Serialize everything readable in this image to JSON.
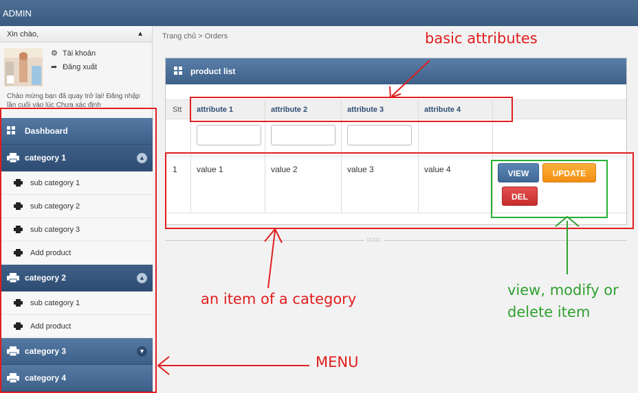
{
  "topbar": {
    "title": "ADMIN"
  },
  "sidebar": {
    "welcome": "Xin chào,",
    "user_links": [
      {
        "label": "Tài khoản",
        "icon": "gear-icon"
      },
      {
        "label": "Đăng xuất",
        "icon": "share-arrow-icon"
      }
    ],
    "greeting": "Chào mừng bạn đã quay trở lại! Đăng nhập lần cuối vào lúc Chưa xác định",
    "dashboard": {
      "label": "Dashboard",
      "icon": "grid-icon"
    },
    "categories": [
      {
        "label": "category 1",
        "expanded": true,
        "items": [
          "sub category 1",
          "sub category 2",
          "sub category 3",
          "Add product"
        ]
      },
      {
        "label": "category 2",
        "expanded": true,
        "items": [
          "sub category 1",
          "Add product"
        ]
      },
      {
        "label": "category 3",
        "expanded": false,
        "items": []
      },
      {
        "label": "category 4",
        "expanded": false,
        "items": []
      }
    ]
  },
  "breadcrumb": {
    "home": "Trang chủ",
    "separator": ">",
    "current": "Orders"
  },
  "panel": {
    "title": "product list",
    "columns": [
      "Stt",
      "attribute 1",
      "attribute 2",
      "attribute 3",
      "attribute 4"
    ],
    "rows": [
      {
        "stt": "1",
        "values": [
          "value 1",
          "value 2",
          "value 3",
          "value 4"
        ]
      }
    ],
    "actions": {
      "view": "VIEW",
      "update": "UPDATE",
      "delete": "DEL"
    }
  },
  "annotations": {
    "basic_attributes": "basic attributes",
    "item_of_category": "an item of a category",
    "view_modify_delete_line1": "view, modify or",
    "view_modify_delete_line2": "delete item",
    "menu": "MENU"
  },
  "colors": {
    "header_blue": "#3d6089",
    "annotation_red": "#e11d1d",
    "annotation_green": "#2ea02e",
    "update_orange": "#f28e12",
    "delete_red": "#c82c2c"
  }
}
